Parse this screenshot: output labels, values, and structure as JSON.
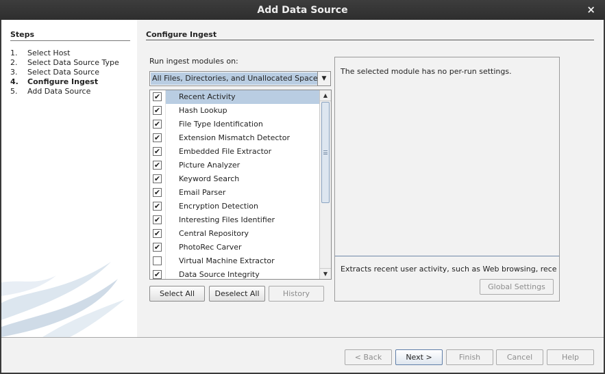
{
  "window": {
    "title": "Add Data Source",
    "close_label": "×"
  },
  "steps": {
    "title": "Steps",
    "items": [
      {
        "num": "1.",
        "label": "Select Host",
        "active": false
      },
      {
        "num": "2.",
        "label": "Select Data Source Type",
        "active": false
      },
      {
        "num": "3.",
        "label": "Select Data Source",
        "active": false
      },
      {
        "num": "4.",
        "label": "Configure Ingest",
        "active": true
      },
      {
        "num": "5.",
        "label": "Add Data Source",
        "active": false
      }
    ]
  },
  "configure": {
    "title": "Configure Ingest",
    "run_label": "Run ingest modules on:",
    "run_value": "All Files, Directories, and Unallocated Space",
    "modules": [
      {
        "label": "Recent Activity",
        "checked": true
      },
      {
        "label": "Hash Lookup",
        "checked": true
      },
      {
        "label": "File Type Identification",
        "checked": true
      },
      {
        "label": "Extension Mismatch Detector",
        "checked": true
      },
      {
        "label": "Embedded File Extractor",
        "checked": true
      },
      {
        "label": "Picture Analyzer",
        "checked": true
      },
      {
        "label": "Keyword Search",
        "checked": true
      },
      {
        "label": "Email Parser",
        "checked": true
      },
      {
        "label": "Encryption Detection",
        "checked": true
      },
      {
        "label": "Interesting Files Identifier",
        "checked": true
      },
      {
        "label": "Central Repository",
        "checked": true
      },
      {
        "label": "PhotoRec Carver",
        "checked": true
      },
      {
        "label": "Virtual Machine Extractor",
        "checked": false
      },
      {
        "label": "Data Source Integrity",
        "checked": true
      }
    ],
    "selected_module": "Recent Activity",
    "buttons": {
      "select_all": "Select All",
      "deselect_all": "Deselect All",
      "history": "History"
    },
    "settings_text": "The selected module has no per-run settings.",
    "description": "Extracts recent user activity, such as Web browsing, recently ...",
    "global_settings": "Global Settings"
  },
  "footer": {
    "back": "< Back",
    "next": "Next >",
    "finish": "Finish",
    "cancel": "Cancel",
    "help": "Help"
  },
  "colors": {
    "selection": "#b9cde2",
    "titlebar": "#333333",
    "panel": "#f2f2f2"
  },
  "icons": {
    "close": "close-icon",
    "combo_arrow": "chevron-down-icon",
    "check": "checkmark-icon"
  }
}
